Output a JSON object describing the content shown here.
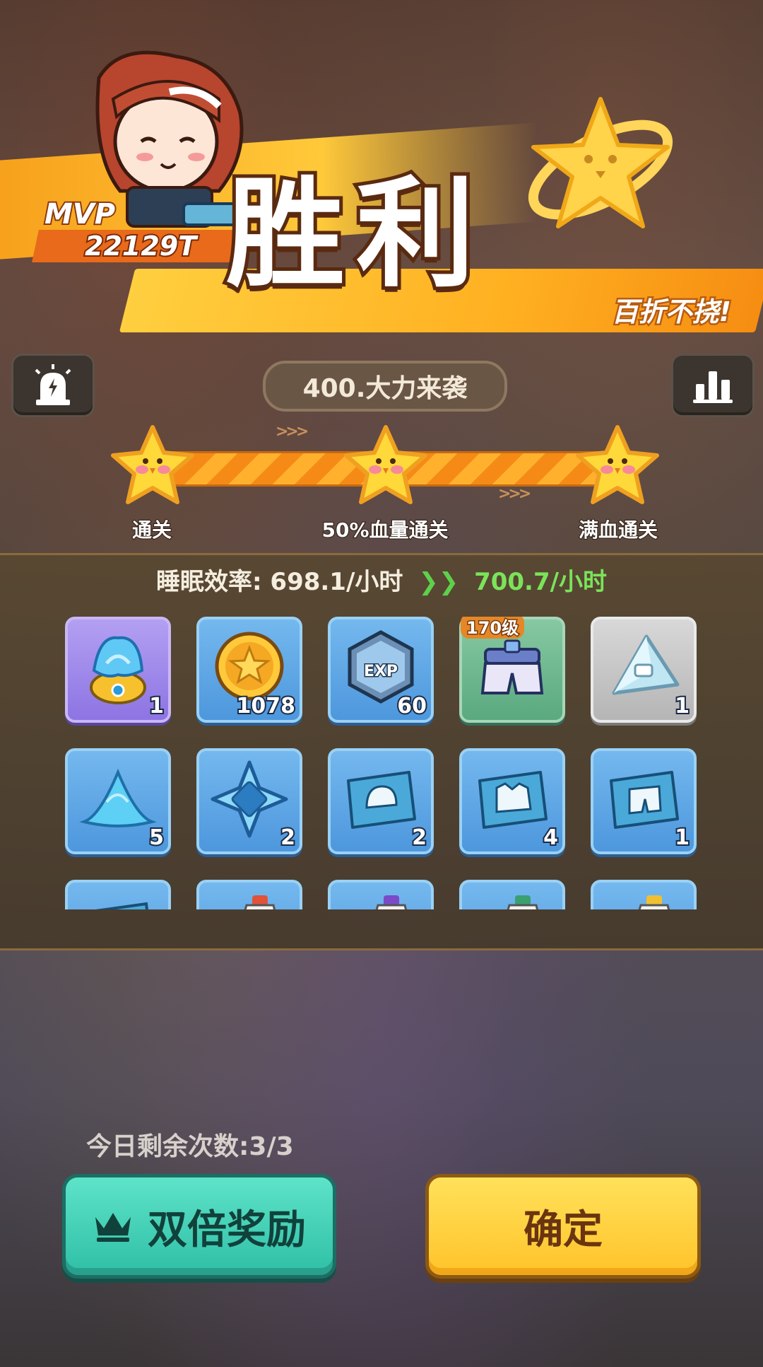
{
  "banner": {
    "title": "胜利",
    "subtitle": "百折不挠!",
    "mvp_label": "MVP",
    "mvp_score": "22129T"
  },
  "stage": {
    "title": "400.大力来袭",
    "progress_fraction": 1.0,
    "goals": [
      {
        "label": "通关",
        "achieved": true
      },
      {
        "label": "50%血量通关",
        "achieved": true
      },
      {
        "label": "满血通关",
        "achieved": true
      }
    ]
  },
  "efficiency": {
    "label": "睡眠效率:",
    "old_value": "698.1/小时",
    "new_value": "700.7/小时"
  },
  "rewards": [
    {
      "icon": "blue-flame-capsule-icon",
      "count": "1",
      "rarity": "purple"
    },
    {
      "icon": "gold-coin-icon",
      "count": "1078",
      "rarity": "blue"
    },
    {
      "icon": "exp-badge-icon",
      "count": "60",
      "rarity": "blue"
    },
    {
      "icon": "shorts-gear-icon",
      "count": "",
      "level": "170级",
      "rarity": "green"
    },
    {
      "icon": "crystal-shard-icon",
      "count": "1",
      "rarity": "grey"
    },
    {
      "icon": "blue-powder-pile-icon",
      "count": "5",
      "rarity": "blue"
    },
    {
      "icon": "blue-crystal-gem-icon",
      "count": "2",
      "rarity": "blue"
    },
    {
      "icon": "helmet-blueprint-icon",
      "count": "2",
      "rarity": "blue"
    },
    {
      "icon": "jacket-blueprint-icon",
      "count": "4",
      "rarity": "blue"
    },
    {
      "icon": "shorts-blueprint-icon",
      "count": "1",
      "rarity": "blue"
    },
    {
      "icon": "blueprint-icon",
      "count": "",
      "rarity": "blue"
    },
    {
      "icon": "potion-bottle-icon",
      "count": "",
      "rarity": "blue"
    },
    {
      "icon": "potion-bottle-icon",
      "count": "",
      "rarity": "blue"
    },
    {
      "icon": "potion-bottle-icon",
      "count": "",
      "rarity": "blue"
    },
    {
      "icon": "potion-bottle-icon",
      "count": "",
      "rarity": "blue"
    }
  ],
  "footer": {
    "remaining": "今日剩余次数:3/3",
    "double_label": "双倍奖励",
    "confirm_label": "确定"
  },
  "colors": {
    "accent_orange": "#f7a11c",
    "double_button": "#2fbfa6",
    "confirm_button": "#ffc32a",
    "efficiency_up": "#7be35a"
  }
}
